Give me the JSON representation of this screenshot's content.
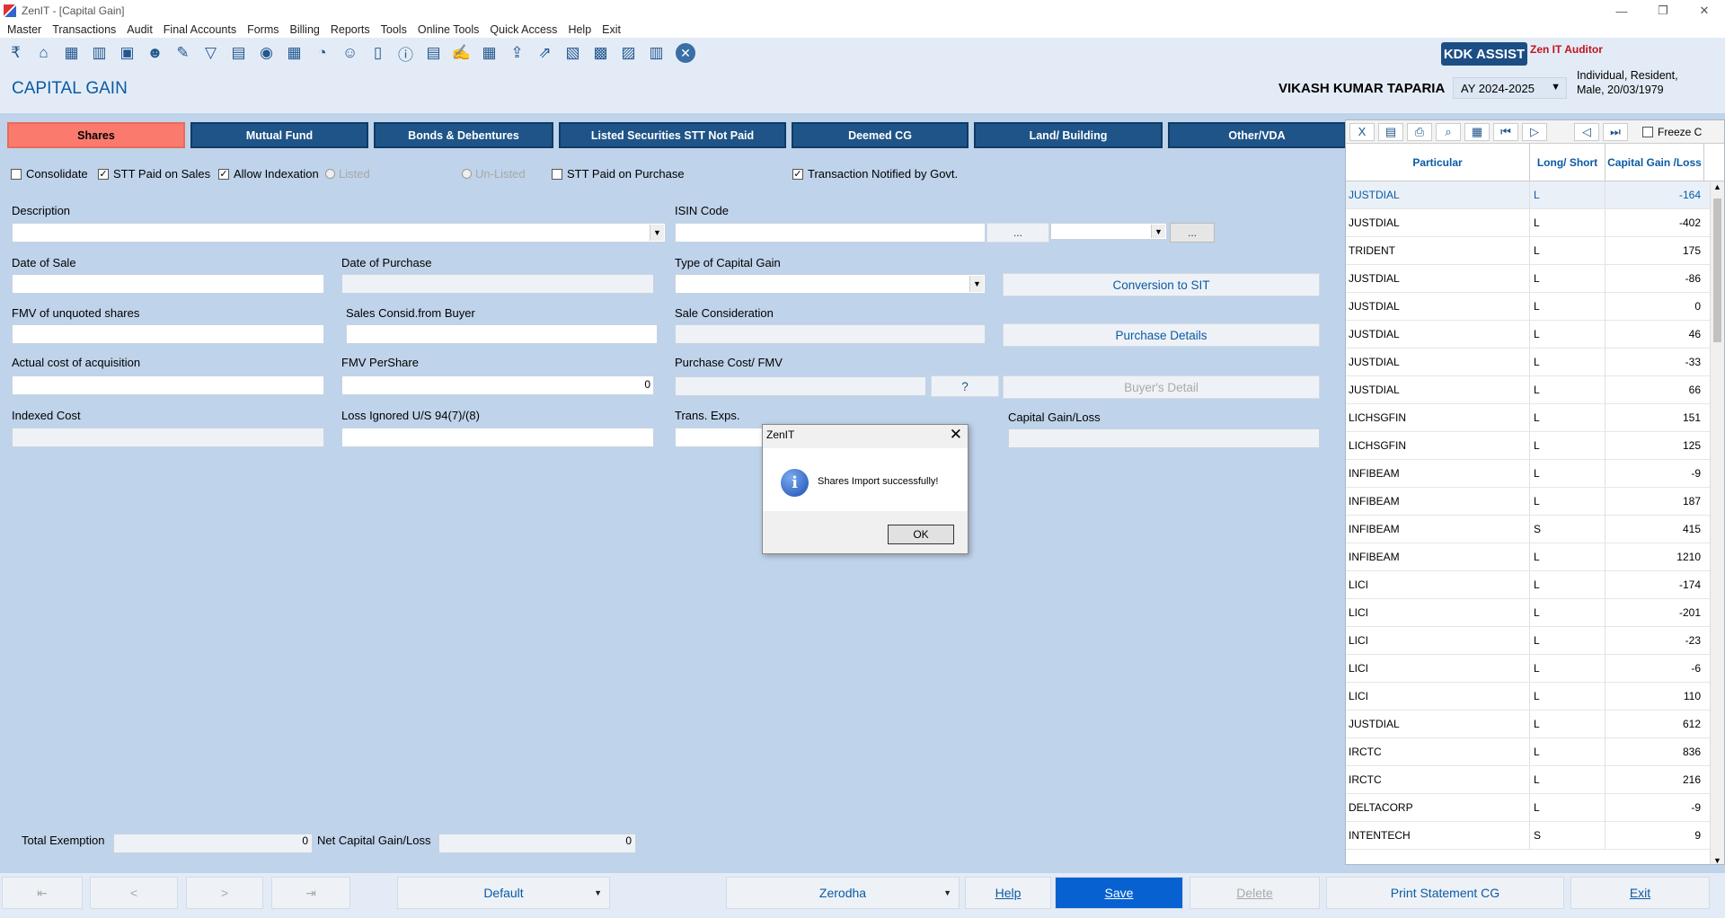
{
  "window": {
    "title": "ZenIT - [Capital Gain]"
  },
  "menu": [
    "Master",
    "Transactions",
    "Audit",
    "Final Accounts",
    "Forms",
    "Billing",
    "Reports",
    "Tools",
    "Online Tools",
    "Quick Access",
    "Help",
    "Exit"
  ],
  "toolbar": {
    "kdk": "KDK ASSIST",
    "auditor": "Zen IT Auditor"
  },
  "header": {
    "page_title": "CAPITAL GAIN",
    "client_name": "VIKASH KUMAR TAPARIA",
    "ay": "AY 2024-2025",
    "info_line1": "Individual, Resident,",
    "info_line2": "Male, 20/03/1979"
  },
  "tabs": [
    "Shares",
    "Mutual Fund",
    "Bonds & Debentures",
    "Listed Securities STT Not Paid",
    "Deemed CG",
    "Land/ Building",
    "Other/VDA"
  ],
  "options": {
    "consolidate": "Consolidate",
    "stt_sales": "STT Paid on Sales",
    "indexation": "Allow Indexation",
    "listed": "Listed",
    "unlisted": "Un-Listed",
    "stt_purchase": "STT Paid on Purchase",
    "notified": "Transaction Notified by Govt."
  },
  "labels": {
    "description": "Description",
    "isin": "ISIN Code",
    "date_sale": "Date of Sale",
    "date_purchase": "Date of Purchase",
    "type_cg": "Type of Capital Gain",
    "fmv_unquoted": "FMV of unquoted shares",
    "sales_consid_buyer": "Sales Consid.from Buyer",
    "sale_consideration": "Sale Consideration",
    "actual_cost": "Actual cost of acquisition",
    "fmv_per_share": "FMV PerShare",
    "purchase_cost_fmv": "Purchase Cost/ FMV",
    "indexed_cost": "Indexed Cost",
    "loss_ignored": "Loss Ignored U/S 94(7)/(8)",
    "trans_exps": "Trans. Exps.",
    "cg_loss": "Capital Gain/Loss"
  },
  "values": {
    "fmv_per_share": "0",
    "total_exemption": "0",
    "net_cg": "0"
  },
  "buttons": {
    "isin_browse": "...",
    "small_browse": "...",
    "conversion_sit": "Conversion to SIT",
    "purchase_details": "Purchase Details",
    "buyers_detail": "Buyer's Detail"
  },
  "totals": {
    "total_exemption": "Total Exemption",
    "net_cg": "Net Capital Gain/Loss"
  },
  "dialog": {
    "title": "ZenIT",
    "message": "Shares Import successfully!",
    "ok": "OK"
  },
  "grid": {
    "freeze": "Freeze C",
    "headers": [
      "Particular",
      "Long/ Short",
      "Capital Gain /Loss"
    ],
    "rows": [
      [
        "JUSTDIAL",
        "L",
        "-164"
      ],
      [
        "JUSTDIAL",
        "L",
        "-402"
      ],
      [
        "TRIDENT",
        "L",
        "175"
      ],
      [
        "JUSTDIAL",
        "L",
        "-86"
      ],
      [
        "JUSTDIAL",
        "L",
        "0"
      ],
      [
        "JUSTDIAL",
        "L",
        "46"
      ],
      [
        "JUSTDIAL",
        "L",
        "-33"
      ],
      [
        "JUSTDIAL",
        "L",
        "66"
      ],
      [
        "LICHSGFIN",
        "L",
        "151"
      ],
      [
        "LICHSGFIN",
        "L",
        "125"
      ],
      [
        "INFIBEAM",
        "L",
        "-9"
      ],
      [
        "INFIBEAM",
        "L",
        "187"
      ],
      [
        "INFIBEAM",
        "S",
        "415"
      ],
      [
        "INFIBEAM",
        "L",
        "1210"
      ],
      [
        "LICI",
        "L",
        "-174"
      ],
      [
        "LICI",
        "L",
        "-201"
      ],
      [
        "LICI",
        "L",
        "-23"
      ],
      [
        "LICI",
        "L",
        "-6"
      ],
      [
        "LICI",
        "L",
        "110"
      ],
      [
        "JUSTDIAL",
        "L",
        "612"
      ],
      [
        "IRCTC",
        "L",
        "836"
      ],
      [
        "IRCTC",
        "L",
        "216"
      ],
      [
        "DELTACORP",
        "L",
        "-9"
      ],
      [
        "INTENTECH",
        "S",
        "9"
      ]
    ]
  },
  "bottom": {
    "first": "⇤",
    "prev": "<",
    "next": ">",
    "last": "⇥",
    "scheme": "Default",
    "broker": "Zerodha",
    "help": "Help",
    "save": "Save",
    "delete": "Delete",
    "print": "Print Statement CG",
    "exit": "Exit"
  }
}
